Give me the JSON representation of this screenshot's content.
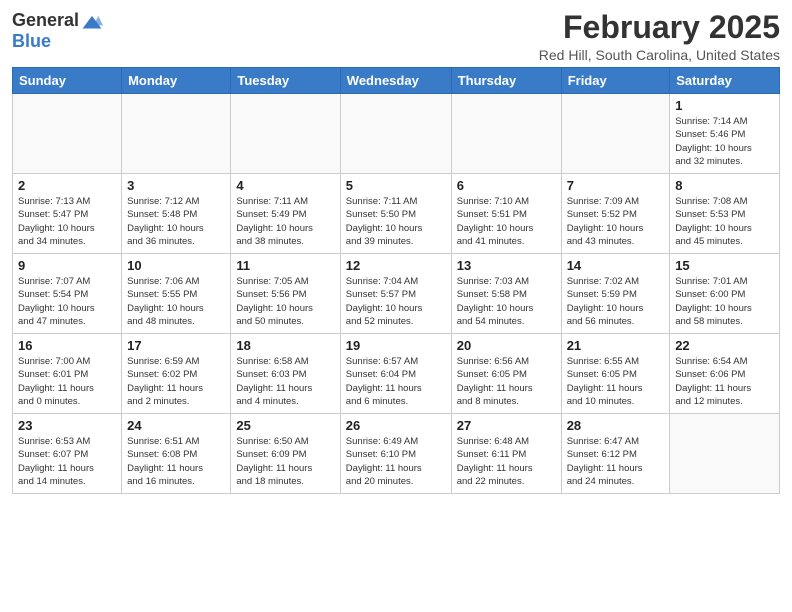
{
  "header": {
    "logo_general": "General",
    "logo_blue": "Blue",
    "title": "February 2025",
    "subtitle": "Red Hill, South Carolina, United States"
  },
  "weekdays": [
    "Sunday",
    "Monday",
    "Tuesday",
    "Wednesday",
    "Thursday",
    "Friday",
    "Saturday"
  ],
  "weeks": [
    [
      {
        "day": "",
        "info": ""
      },
      {
        "day": "",
        "info": ""
      },
      {
        "day": "",
        "info": ""
      },
      {
        "day": "",
        "info": ""
      },
      {
        "day": "",
        "info": ""
      },
      {
        "day": "",
        "info": ""
      },
      {
        "day": "1",
        "info": "Sunrise: 7:14 AM\nSunset: 5:46 PM\nDaylight: 10 hours\nand 32 minutes."
      }
    ],
    [
      {
        "day": "2",
        "info": "Sunrise: 7:13 AM\nSunset: 5:47 PM\nDaylight: 10 hours\nand 34 minutes."
      },
      {
        "day": "3",
        "info": "Sunrise: 7:12 AM\nSunset: 5:48 PM\nDaylight: 10 hours\nand 36 minutes."
      },
      {
        "day": "4",
        "info": "Sunrise: 7:11 AM\nSunset: 5:49 PM\nDaylight: 10 hours\nand 38 minutes."
      },
      {
        "day": "5",
        "info": "Sunrise: 7:11 AM\nSunset: 5:50 PM\nDaylight: 10 hours\nand 39 minutes."
      },
      {
        "day": "6",
        "info": "Sunrise: 7:10 AM\nSunset: 5:51 PM\nDaylight: 10 hours\nand 41 minutes."
      },
      {
        "day": "7",
        "info": "Sunrise: 7:09 AM\nSunset: 5:52 PM\nDaylight: 10 hours\nand 43 minutes."
      },
      {
        "day": "8",
        "info": "Sunrise: 7:08 AM\nSunset: 5:53 PM\nDaylight: 10 hours\nand 45 minutes."
      }
    ],
    [
      {
        "day": "9",
        "info": "Sunrise: 7:07 AM\nSunset: 5:54 PM\nDaylight: 10 hours\nand 47 minutes."
      },
      {
        "day": "10",
        "info": "Sunrise: 7:06 AM\nSunset: 5:55 PM\nDaylight: 10 hours\nand 48 minutes."
      },
      {
        "day": "11",
        "info": "Sunrise: 7:05 AM\nSunset: 5:56 PM\nDaylight: 10 hours\nand 50 minutes."
      },
      {
        "day": "12",
        "info": "Sunrise: 7:04 AM\nSunset: 5:57 PM\nDaylight: 10 hours\nand 52 minutes."
      },
      {
        "day": "13",
        "info": "Sunrise: 7:03 AM\nSunset: 5:58 PM\nDaylight: 10 hours\nand 54 minutes."
      },
      {
        "day": "14",
        "info": "Sunrise: 7:02 AM\nSunset: 5:59 PM\nDaylight: 10 hours\nand 56 minutes."
      },
      {
        "day": "15",
        "info": "Sunrise: 7:01 AM\nSunset: 6:00 PM\nDaylight: 10 hours\nand 58 minutes."
      }
    ],
    [
      {
        "day": "16",
        "info": "Sunrise: 7:00 AM\nSunset: 6:01 PM\nDaylight: 11 hours\nand 0 minutes."
      },
      {
        "day": "17",
        "info": "Sunrise: 6:59 AM\nSunset: 6:02 PM\nDaylight: 11 hours\nand 2 minutes."
      },
      {
        "day": "18",
        "info": "Sunrise: 6:58 AM\nSunset: 6:03 PM\nDaylight: 11 hours\nand 4 minutes."
      },
      {
        "day": "19",
        "info": "Sunrise: 6:57 AM\nSunset: 6:04 PM\nDaylight: 11 hours\nand 6 minutes."
      },
      {
        "day": "20",
        "info": "Sunrise: 6:56 AM\nSunset: 6:05 PM\nDaylight: 11 hours\nand 8 minutes."
      },
      {
        "day": "21",
        "info": "Sunrise: 6:55 AM\nSunset: 6:05 PM\nDaylight: 11 hours\nand 10 minutes."
      },
      {
        "day": "22",
        "info": "Sunrise: 6:54 AM\nSunset: 6:06 PM\nDaylight: 11 hours\nand 12 minutes."
      }
    ],
    [
      {
        "day": "23",
        "info": "Sunrise: 6:53 AM\nSunset: 6:07 PM\nDaylight: 11 hours\nand 14 minutes."
      },
      {
        "day": "24",
        "info": "Sunrise: 6:51 AM\nSunset: 6:08 PM\nDaylight: 11 hours\nand 16 minutes."
      },
      {
        "day": "25",
        "info": "Sunrise: 6:50 AM\nSunset: 6:09 PM\nDaylight: 11 hours\nand 18 minutes."
      },
      {
        "day": "26",
        "info": "Sunrise: 6:49 AM\nSunset: 6:10 PM\nDaylight: 11 hours\nand 20 minutes."
      },
      {
        "day": "27",
        "info": "Sunrise: 6:48 AM\nSunset: 6:11 PM\nDaylight: 11 hours\nand 22 minutes."
      },
      {
        "day": "28",
        "info": "Sunrise: 6:47 AM\nSunset: 6:12 PM\nDaylight: 11 hours\nand 24 minutes."
      },
      {
        "day": "",
        "info": ""
      }
    ]
  ]
}
